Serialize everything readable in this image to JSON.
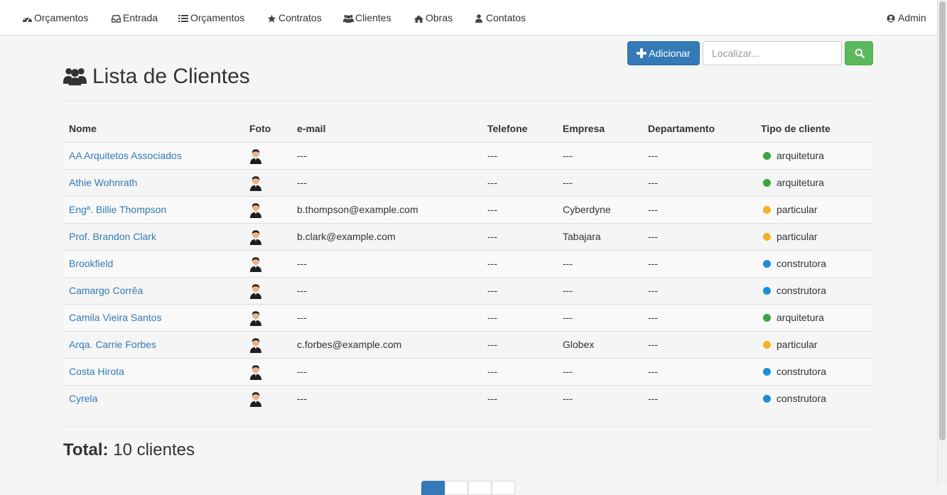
{
  "nav": {
    "items": [
      {
        "label": "Orçamentos",
        "icon": "dashboard-gauge-icon"
      },
      {
        "label": "Entrada",
        "icon": "inbox-tray-icon"
      },
      {
        "label": "Orçamentos",
        "icon": "list-icon"
      },
      {
        "label": "Contratos",
        "icon": "star-icon"
      },
      {
        "label": "Clientes",
        "icon": "users-group-icon"
      },
      {
        "label": "Obras",
        "icon": "home-icon"
      },
      {
        "label": "Contatos",
        "icon": "user-icon"
      }
    ],
    "user": {
      "label": "Admin",
      "icon": "user-circle-icon"
    }
  },
  "toolbar": {
    "add_label": "Adicionar",
    "search_placeholder": "Localizar..."
  },
  "page": {
    "title": "Lista de Clientes"
  },
  "table": {
    "headers": [
      "Nome",
      "Foto",
      "e-mail",
      "Telefone",
      "Empresa",
      "Departamento",
      "Tipo de cliente"
    ],
    "rows": [
      {
        "nome": "AA Arquitetos Associados",
        "email": "---",
        "telefone": "---",
        "empresa": "---",
        "departamento": "---",
        "tipo": "arquitetura",
        "tipo_color": "#3aa641"
      },
      {
        "nome": "Athie Wohnrath",
        "email": "---",
        "telefone": "---",
        "empresa": "---",
        "departamento": "---",
        "tipo": "arquitetura",
        "tipo_color": "#3aa641"
      },
      {
        "nome": "Engª. Billie Thompson",
        "email": "b.thompson@example.com",
        "telefone": "---",
        "empresa": "Cyberdyne",
        "departamento": "---",
        "tipo": "particular",
        "tipo_color": "#f5b324"
      },
      {
        "nome": "Prof. Brandon Clark",
        "email": "b.clark@example.com",
        "telefone": "---",
        "empresa": "Tabajara",
        "departamento": "---",
        "tipo": "particular",
        "tipo_color": "#f5b324"
      },
      {
        "nome": "Brookfield",
        "email": "---",
        "telefone": "---",
        "empresa": "---",
        "departamento": "---",
        "tipo": "construtora",
        "tipo_color": "#1a8fd8"
      },
      {
        "nome": "Camargo Corrêa",
        "email": "---",
        "telefone": "---",
        "empresa": "---",
        "departamento": "---",
        "tipo": "construtora",
        "tipo_color": "#1a8fd8"
      },
      {
        "nome": "Camila Vieira Santos",
        "email": "---",
        "telefone": "---",
        "empresa": "---",
        "departamento": "---",
        "tipo": "arquitetura",
        "tipo_color": "#3aa641"
      },
      {
        "nome": "Arqa. Carrie Forbes",
        "email": "c.forbes@example.com",
        "telefone": "---",
        "empresa": "Globex",
        "departamento": "---",
        "tipo": "particular",
        "tipo_color": "#f5b324"
      },
      {
        "nome": "Costa Hirota",
        "email": "---",
        "telefone": "---",
        "empresa": "---",
        "departamento": "---",
        "tipo": "construtora",
        "tipo_color": "#1a8fd8"
      },
      {
        "nome": "Cyrela",
        "email": "---",
        "telefone": "---",
        "empresa": "---",
        "departamento": "---",
        "tipo": "construtora",
        "tipo_color": "#1a8fd8"
      }
    ]
  },
  "summary": {
    "total_label": "Total:",
    "total_value": "10 clientes"
  },
  "colors": {
    "primary": "#337ab7",
    "success": "#5cb85c",
    "link": "#337ab7"
  }
}
